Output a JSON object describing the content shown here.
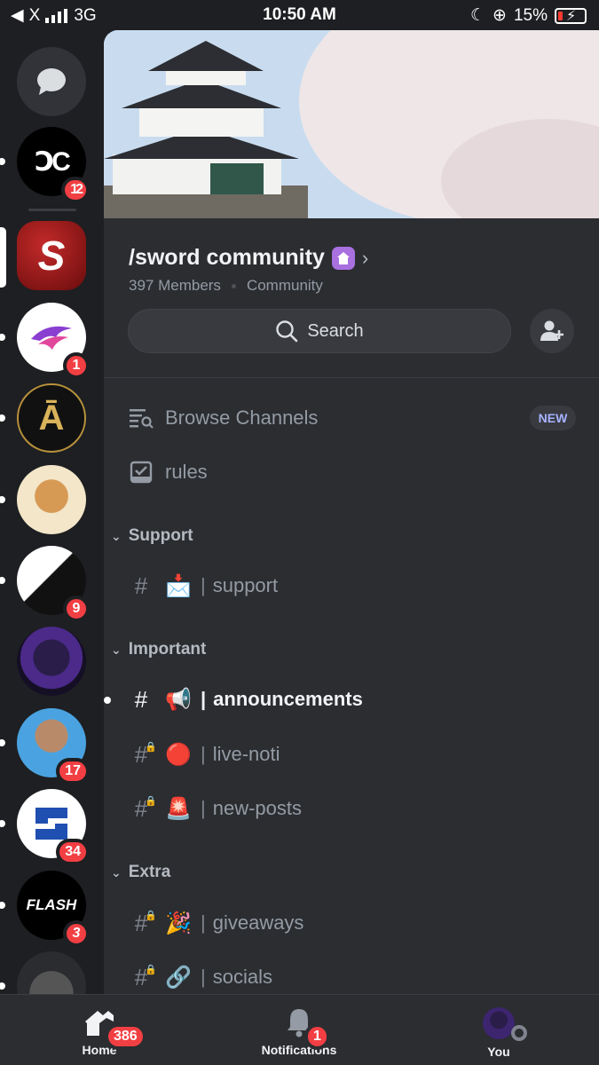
{
  "status_bar": {
    "carrier": "X",
    "network": "3G",
    "time": "10:50 AM",
    "battery": "15%"
  },
  "servers": [
    {
      "name": "AC",
      "badge": "12"
    },
    {
      "name": "S",
      "badge": ""
    },
    {
      "name": "eagle",
      "badge": "1"
    },
    {
      "name": "A",
      "badge": ""
    },
    {
      "name": "eevee",
      "badge": ""
    },
    {
      "name": "art",
      "badge": "9"
    },
    {
      "name": "hooded",
      "badge": ""
    },
    {
      "name": "avatar",
      "badge": "17"
    },
    {
      "name": "S-logo",
      "badge": "34"
    },
    {
      "name": "FLASH",
      "badge": "3"
    }
  ],
  "guild": {
    "name": "/sword community",
    "members": "397 Members",
    "type": "Community"
  },
  "search": {
    "label": "Search"
  },
  "channels": {
    "browse": "Browse Channels",
    "new_badge": "NEW",
    "rules": "rules",
    "categories": [
      {
        "name": "Support",
        "channels": [
          {
            "emoji": "📩",
            "name": "support"
          }
        ]
      },
      {
        "name": "Important",
        "channels": [
          {
            "emoji": "📢",
            "name": "announcements"
          },
          {
            "emoji": "🔴",
            "name": "live-noti"
          },
          {
            "emoji": "🚨",
            "name": "new-posts"
          }
        ]
      },
      {
        "name": "Extra",
        "channels": [
          {
            "emoji": "🎉",
            "name": "giveaways"
          },
          {
            "emoji": "🔗",
            "name": "socials"
          }
        ]
      }
    ]
  },
  "tabs": {
    "home": {
      "label": "Home",
      "badge": "386"
    },
    "notifications": {
      "label": "Notifications",
      "badge": "1"
    },
    "you": {
      "label": "You"
    }
  },
  "colors": {
    "background": "#1e1f22",
    "panel": "#2b2d31",
    "badge": "#f23f43",
    "new": "#a7b2ff"
  }
}
